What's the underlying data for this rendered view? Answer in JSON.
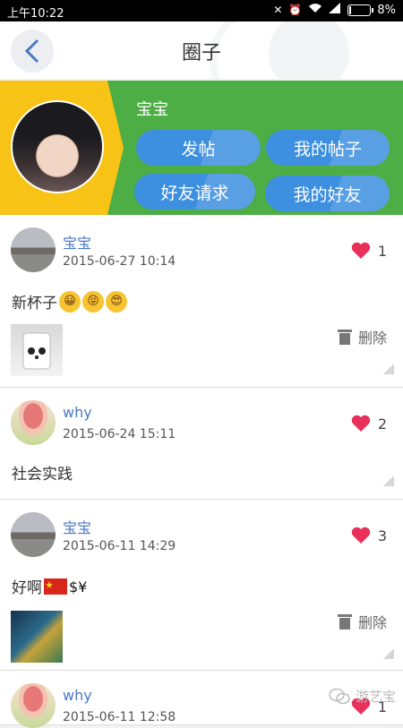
{
  "status_bar": {
    "time": "上午10:22",
    "battery": "8%",
    "battery_level": 0.08
  },
  "header": {
    "title": "圈子"
  },
  "profile": {
    "name": "宝宝",
    "buttons": [
      "发帖",
      "我的帖子",
      "好友请求",
      "我的好友"
    ]
  },
  "posts": [
    {
      "author": "宝宝",
      "date": "2015-06-27 10:14",
      "likes": "1",
      "text": "新杯子",
      "emojis": [
        "grin",
        "squint",
        "heart-eyes"
      ],
      "delete_label": "删除",
      "has_image": true
    },
    {
      "author": "why",
      "date": "2015-06-24 15:11",
      "likes": "2",
      "text": "社会实践",
      "delete_label": "",
      "has_image": false
    },
    {
      "author": "宝宝",
      "date": "2015-06-11 14:29",
      "likes": "3",
      "text": "好啊",
      "emojis": [
        "china-flag",
        "money"
      ],
      "delete_label": "删除",
      "has_image": true
    },
    {
      "author": "why",
      "date": "2015-06-11 12:58",
      "likes": "1"
    }
  ],
  "watermark": "游艺宝",
  "colors": {
    "banner_green": "#4cae45",
    "banner_yellow": "#f6c316",
    "pill_blue": "#3d8fe0",
    "heart": "#e8305a",
    "author_blue": "#4a78c5"
  }
}
